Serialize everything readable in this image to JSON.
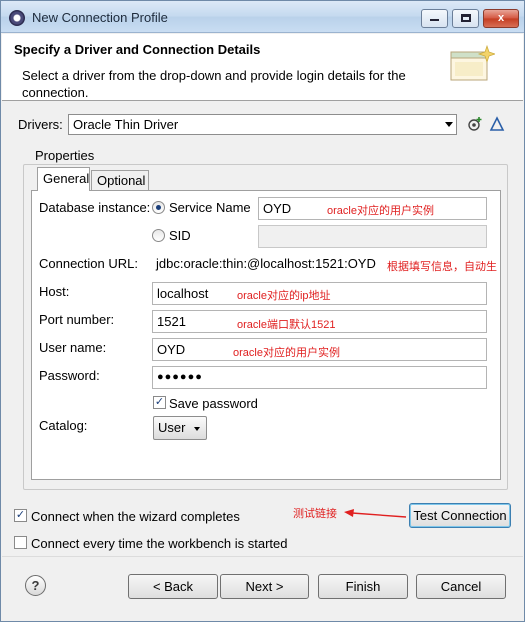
{
  "window": {
    "title": "New Connection Profile",
    "minimize": "",
    "maximize": "",
    "close": "x"
  },
  "banner": {
    "heading": "Specify a Driver and Connection Details",
    "description": "Select a driver from the drop-down and provide login details for the connection."
  },
  "drivers": {
    "label": "Drivers:",
    "selected": "Oracle Thin Driver",
    "icons": [
      "new-driver-icon",
      "edit-driver-icon"
    ]
  },
  "properties": {
    "group_title": "Properties",
    "tabs": [
      {
        "label": "General",
        "active": true
      },
      {
        "label": "Optional",
        "active": false
      }
    ],
    "database_instance": {
      "label": "Database instance:",
      "service_name_label": "Service Name",
      "service_name_selected": true,
      "service_name_value": "OYD",
      "service_name_note": "oracle对应的用户实例",
      "sid_label": "SID",
      "sid_value": ""
    },
    "connection_url": {
      "label": "Connection URL:",
      "value": "jdbc:oracle:thin:@localhost:1521:OYD",
      "note": "根据填写信息，自动生"
    },
    "host": {
      "label": "Host:",
      "value": "localhost",
      "note": "oracle对应的ip地址"
    },
    "port": {
      "label": "Port number:",
      "value": "1521",
      "note": "oracle端口默认1521"
    },
    "user": {
      "label": "User name:",
      "value": "OYD",
      "note": "oracle对应的用户实例"
    },
    "password": {
      "label": "Password:",
      "value": "●●●●●●"
    },
    "save_password": {
      "label": "Save password",
      "checked": true
    },
    "catalog": {
      "label": "Catalog:",
      "selected": "User"
    }
  },
  "options": {
    "connect_on_complete": {
      "label": "Connect when the wizard completes",
      "checked": true
    },
    "connect_every_time": {
      "label": "Connect every time the workbench is started",
      "checked": false
    },
    "test_annotation": "测试链接",
    "test_button": "Test Connection"
  },
  "footer": {
    "help": "?",
    "back": "< Back",
    "next": "Next >",
    "finish": "Finish",
    "cancel": "Cancel"
  },
  "colors": {
    "annotation": "#e02020",
    "accent": "#3c7fb1"
  }
}
